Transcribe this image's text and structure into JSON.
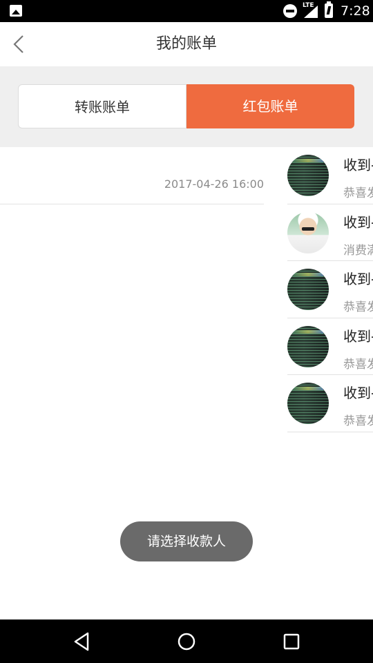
{
  "status_bar": {
    "time": "7:28",
    "network": "LTE",
    "icons": [
      "gallery-icon",
      "do-not-disturb-icon",
      "signal-icon",
      "battery-icon"
    ]
  },
  "header": {
    "title": "我的账单",
    "back_icon": "chevron-left-icon"
  },
  "tabs": [
    {
      "label": "转账账单",
      "active": false
    },
    {
      "label": "红包账单",
      "active": true
    }
  ],
  "colors": {
    "accent": "#ef6b3f",
    "tab_bg": "#efefef",
    "toast_bg": "#6a6a6a"
  },
  "left_entry": {
    "date": "2017-04-26 16:00"
  },
  "records": [
    {
      "title": "收到-",
      "subtitle": "恭喜发",
      "avatar": "code-screen-avatar"
    },
    {
      "title": "收到-",
      "subtitle": "消费满",
      "avatar": "person-photo-avatar"
    },
    {
      "title": "收到-",
      "subtitle": "恭喜发",
      "avatar": "code-screen-avatar"
    },
    {
      "title": "收到-",
      "subtitle": "恭喜发",
      "avatar": "code-screen-avatar"
    },
    {
      "title": "收到-",
      "subtitle": "恭喜发",
      "avatar": "code-screen-avatar"
    }
  ],
  "toast": {
    "text": "请选择收款人"
  },
  "nav_bar": {
    "icons": [
      "nav-back-icon",
      "nav-home-icon",
      "nav-recents-icon"
    ]
  }
}
